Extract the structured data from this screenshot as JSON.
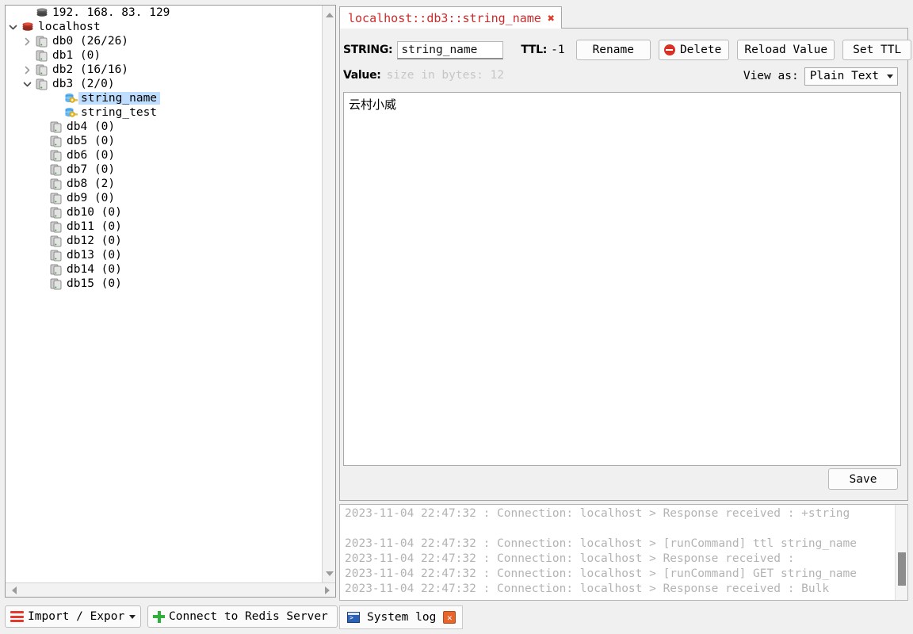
{
  "tree": {
    "items": [
      {
        "indent": 1,
        "twisty": "none",
        "icon": "server-icon-offline",
        "label": "192. 168. 83. 129",
        "selected": false
      },
      {
        "indent": 0,
        "twisty": "expanded",
        "icon": "redis-server-icon",
        "label": "localhost",
        "selected": false
      },
      {
        "indent": 1,
        "twisty": "collapsed",
        "icon": "database-icon",
        "label": "db0  (26/26)",
        "selected": false
      },
      {
        "indent": 1,
        "twisty": "none",
        "icon": "database-icon",
        "label": "db1 (0)",
        "selected": false
      },
      {
        "indent": 1,
        "twisty": "collapsed",
        "icon": "database-icon",
        "label": "db2  (16/16)",
        "selected": false
      },
      {
        "indent": 1,
        "twisty": "expanded",
        "icon": "database-icon",
        "label": "db3  (2/0)",
        "selected": false
      },
      {
        "indent": 3,
        "twisty": "none",
        "icon": "key-icon",
        "label": "string_name",
        "selected": true
      },
      {
        "indent": 3,
        "twisty": "none",
        "icon": "key-icon",
        "label": "string_test",
        "selected": false
      },
      {
        "indent": 2,
        "twisty": "none",
        "icon": "database-icon",
        "label": "db4 (0)",
        "selected": false
      },
      {
        "indent": 2,
        "twisty": "none",
        "icon": "database-icon",
        "label": "db5 (0)",
        "selected": false
      },
      {
        "indent": 2,
        "twisty": "none",
        "icon": "database-icon",
        "label": "db6 (0)",
        "selected": false
      },
      {
        "indent": 2,
        "twisty": "none",
        "icon": "database-icon",
        "label": "db7 (0)",
        "selected": false
      },
      {
        "indent": 2,
        "twisty": "none",
        "icon": "database-icon",
        "label": "db8 (2)",
        "selected": false
      },
      {
        "indent": 2,
        "twisty": "none",
        "icon": "database-icon",
        "label": "db9 (0)",
        "selected": false
      },
      {
        "indent": 2,
        "twisty": "none",
        "icon": "database-icon",
        "label": "db10 (0)",
        "selected": false
      },
      {
        "indent": 2,
        "twisty": "none",
        "icon": "database-icon",
        "label": "db11 (0)",
        "selected": false
      },
      {
        "indent": 2,
        "twisty": "none",
        "icon": "database-icon",
        "label": "db12 (0)",
        "selected": false
      },
      {
        "indent": 2,
        "twisty": "none",
        "icon": "database-icon",
        "label": "db13 (0)",
        "selected": false
      },
      {
        "indent": 2,
        "twisty": "none",
        "icon": "database-icon",
        "label": "db14 (0)",
        "selected": false
      },
      {
        "indent": 2,
        "twisty": "none",
        "icon": "database-icon",
        "label": "db15 (0)",
        "selected": false
      }
    ]
  },
  "editor": {
    "tab": {
      "title": "localhost::db3::string_name",
      "close": "✖",
      "color": "#cc2b2b"
    },
    "type_label": "STRING:",
    "key_name": "string_name",
    "ttl_label": "TTL:",
    "ttl_value": "-1",
    "buttons": {
      "rename": "Rename",
      "delete": "Delete",
      "reload": "Reload Value",
      "set_ttl": "Set TTL",
      "save": "Save"
    },
    "value_label": "Value:",
    "size_hint": "size in bytes: 12",
    "view_as_label": "View as:",
    "view_as_value": "Plain Text",
    "value_text": "云村小威"
  },
  "log": {
    "lines": [
      "2023-11-04 22:47:32 : Connection: localhost > Response received : +string",
      "",
      "2023-11-04 22:47:32 : Connection: localhost > [runCommand] ttl string_name",
      "2023-11-04 22:47:32 : Connection: localhost > Response received :",
      "2023-11-04 22:47:32 : Connection: localhost > [runCommand] GET string_name",
      "2023-11-04 22:47:32 : Connection: localhost > Response received : Bulk"
    ]
  },
  "bottom": {
    "import_export": "Import / Expor",
    "connect": "Connect to Redis Server",
    "system_log_tab": "System log",
    "system_log_close": "✕"
  }
}
